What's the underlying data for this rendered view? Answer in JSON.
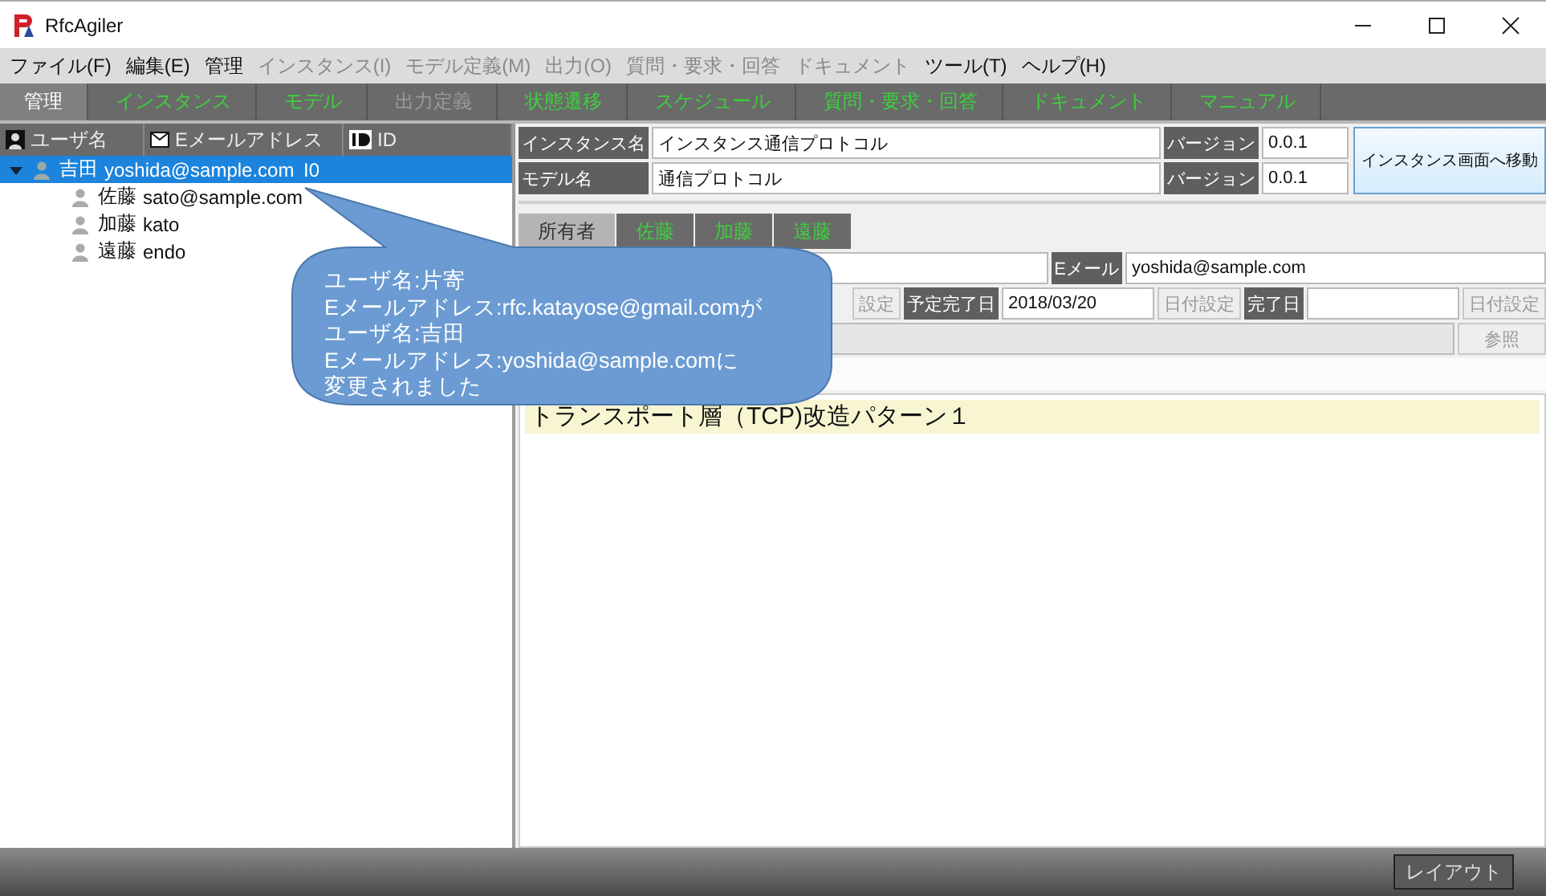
{
  "window": {
    "title": "RfcAgiler"
  },
  "menu": [
    {
      "label": "ファイル(F)",
      "disabled": false
    },
    {
      "label": "編集(E)",
      "disabled": false
    },
    {
      "label": "管理",
      "disabled": false
    },
    {
      "label": "インスタンス(I)",
      "disabled": true
    },
    {
      "label": "モデル定義(M)",
      "disabled": true
    },
    {
      "label": "出力(O)",
      "disabled": true
    },
    {
      "label": "質問・要求・回答",
      "disabled": true
    },
    {
      "label": "ドキュメント",
      "disabled": true
    },
    {
      "label": "ツール(T)",
      "disabled": false
    },
    {
      "label": "ヘルプ(H)",
      "disabled": false
    }
  ],
  "tabs": [
    {
      "label": "管理",
      "selected": true,
      "disabled": false
    },
    {
      "label": "インスタンス",
      "selected": false,
      "disabled": false
    },
    {
      "label": "モデル",
      "selected": false,
      "disabled": false
    },
    {
      "label": "出力定義",
      "selected": false,
      "disabled": true
    },
    {
      "label": "状態遷移",
      "selected": false,
      "disabled": false
    },
    {
      "label": "スケジュール",
      "selected": false,
      "disabled": false
    },
    {
      "label": "質問・要求・回答",
      "selected": false,
      "disabled": false
    },
    {
      "label": "ドキュメント",
      "selected": false,
      "disabled": false
    },
    {
      "label": "マニュアル",
      "selected": false,
      "disabled": false
    }
  ],
  "user_tree": {
    "columns": [
      "ユーザ名",
      "Eメールアドレス",
      "ID"
    ],
    "rows": [
      {
        "name": "吉田",
        "email": "yoshida@sample.com",
        "id": "I0",
        "selected": true,
        "expanded": true,
        "children": [
          {
            "name": "佐藤",
            "email": "sato@sample.com",
            "selected": false
          },
          {
            "name": "加藤",
            "email": "kato",
            "selected": false
          },
          {
            "name": "遠藤",
            "email": "endo",
            "selected": false
          }
        ]
      }
    ]
  },
  "callout": {
    "lines": [
      "ユーザ名:片寄",
      "Eメールアドレス:rfc.katayose@gmail.comが",
      "ユーザ名:吉田",
      "Eメールアドレス:yoshida@sample.comに",
      "変更されました"
    ]
  },
  "instance": {
    "instance_label": "インスタンス名",
    "instance_name": "インスタンス通信プロトコル",
    "version_label_1": "バージョン",
    "instance_version": "0.0.1",
    "model_label": "モデル名",
    "model_name": "通信プロトコル",
    "version_label_2": "バージョン",
    "model_version": "0.0.1",
    "move_button": "インスタンス画面へ移動"
  },
  "member_tabs": [
    {
      "label": "所有者",
      "selected": true
    },
    {
      "label": "佐藤",
      "selected": false
    },
    {
      "label": "加藤",
      "selected": false
    },
    {
      "label": "遠藤",
      "selected": false
    }
  ],
  "details": {
    "email_label": "Eメール",
    "email": "yoshida@sample.com",
    "date_button_partial": "設定",
    "planned_label": "予定完了日",
    "planned_date": "2018/03/20",
    "date_button_1": "日付設定",
    "done_label": "完了日",
    "date_button_2": "日付設定",
    "browse_button": "参照"
  },
  "note": "トランスポート層（TCP)改造パターン１",
  "status_bar": {
    "layout_button": "レイアウト"
  }
}
